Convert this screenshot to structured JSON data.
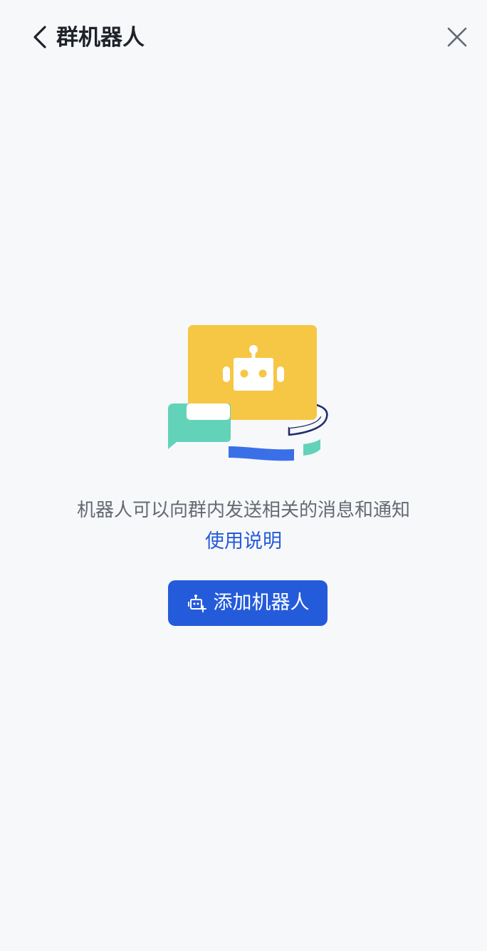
{
  "header": {
    "title": "群机器人",
    "back_icon": "chevron-left-icon",
    "close_icon": "close-icon"
  },
  "empty_state": {
    "illustration": "robot-chat-illustration",
    "description": "机器人可以向群内发送相关的消息和通知",
    "help_link": "使用说明",
    "add_button_label": "添加机器人",
    "add_button_icon": "add-robot-icon"
  },
  "colors": {
    "background": "#f7f8fa",
    "title": "#1f2329",
    "description": "#646a73",
    "accent": "#245bdb",
    "illustration_yellow": "#f6c744",
    "illustration_teal": "#62d2b8",
    "illustration_blue": "#3b6fe8",
    "illustration_navy": "#1f2f6b"
  }
}
